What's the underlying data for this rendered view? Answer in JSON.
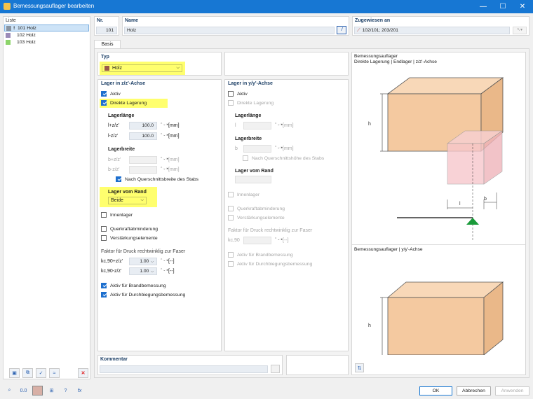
{
  "window": {
    "title": "Bemessungsauflager bearbeiten",
    "minimize": "—",
    "maximize": "☐",
    "close": "✕"
  },
  "list": {
    "header": "Liste",
    "items": [
      {
        "label": "101  Holz",
        "color": "#8a94a0",
        "marker": "!"
      },
      {
        "label": "102  Holz",
        "color": "#9b8bb8",
        "marker": ""
      },
      {
        "label": "103  Holz",
        "color": "#8cd46a",
        "marker": ""
      }
    ]
  },
  "top": {
    "nr_label": "Nr.",
    "nr_value": "101",
    "name_label": "Name",
    "name_value": "Holz",
    "assigned_label": "Zugewiesen an",
    "assigned_value": "102/101; 203/201"
  },
  "tabs": [
    "Basis"
  ],
  "typ": {
    "header": "Typ",
    "value": "Holz",
    "color": "#9a5a4a"
  },
  "z": {
    "header": "Lager in z/z'-Achse",
    "aktiv": "Aktiv",
    "direkt": "Direkte Lagerung",
    "laenge_header": "Lagerlänge",
    "l1_label": "l+z/z'",
    "l1_value": "100.0",
    "l2_label": "l-z/z'",
    "l2_value": "100.0",
    "unit_mm": "[mm]",
    "breite_header": "Lagerbreite",
    "b1_label": "b+z/z'",
    "b2_label": "b-z/z'",
    "nach_quer": "Nach Querschnittsbreite des Stabs",
    "rand_header": "Lager vom Rand",
    "rand_value": "Beide",
    "innenlager": "Innenlager",
    "querkraft": "Querkraftabminderung",
    "verstaerkung": "Verstärkungselemente",
    "faktor_header": "Faktor für Druck rechtwinklig zur Faser",
    "k1_label": "kc,90+z/z'",
    "k1_value": "1.00",
    "k2_label": "kc,90-z/z'",
    "k2_value": "1.00",
    "unit_dash": "[--]",
    "brand": "Aktiv für Brandbemessung",
    "durchbiegung": "Aktiv für Durchbiegungsbemessung"
  },
  "y": {
    "header": "Lager in y/y'-Achse",
    "aktiv": "Aktiv",
    "direkt": "Direkte Lagerung",
    "laenge_header": "Lagerlänge",
    "l_label": "l",
    "unit_mm": "[mm]",
    "breite_header": "Lagerbreite",
    "b_label": "b",
    "nach_quer": "Nach Querschnittshöhe des Stabs",
    "rand_header": "Lager vom Rand",
    "innenlager": "Innenlager",
    "querkraft": "Querkraftabminderung",
    "verstaerkung": "Verstärkungselemente",
    "faktor_header": "Faktor für Druck rechtwinklig zur Faser",
    "k_label": "kc,90",
    "unit_dash": "[--]",
    "brand": "Aktiv für Brandbemessung",
    "durchbiegung": "Aktiv für Durchbiegungsbemessung"
  },
  "preview": {
    "title1": "Bemessungsauflager",
    "subtitle1": "Direkte Lagerung | Endlager | z/z'-Achse",
    "h": "h",
    "l": "l",
    "b": "b",
    "title2": "Bemessungsauflager | y/y'-Achse"
  },
  "kommentar": {
    "label": "Kommentar"
  },
  "buttons": {
    "ok": "OK",
    "cancel": "Abbrechen",
    "apply": "Anwenden"
  }
}
